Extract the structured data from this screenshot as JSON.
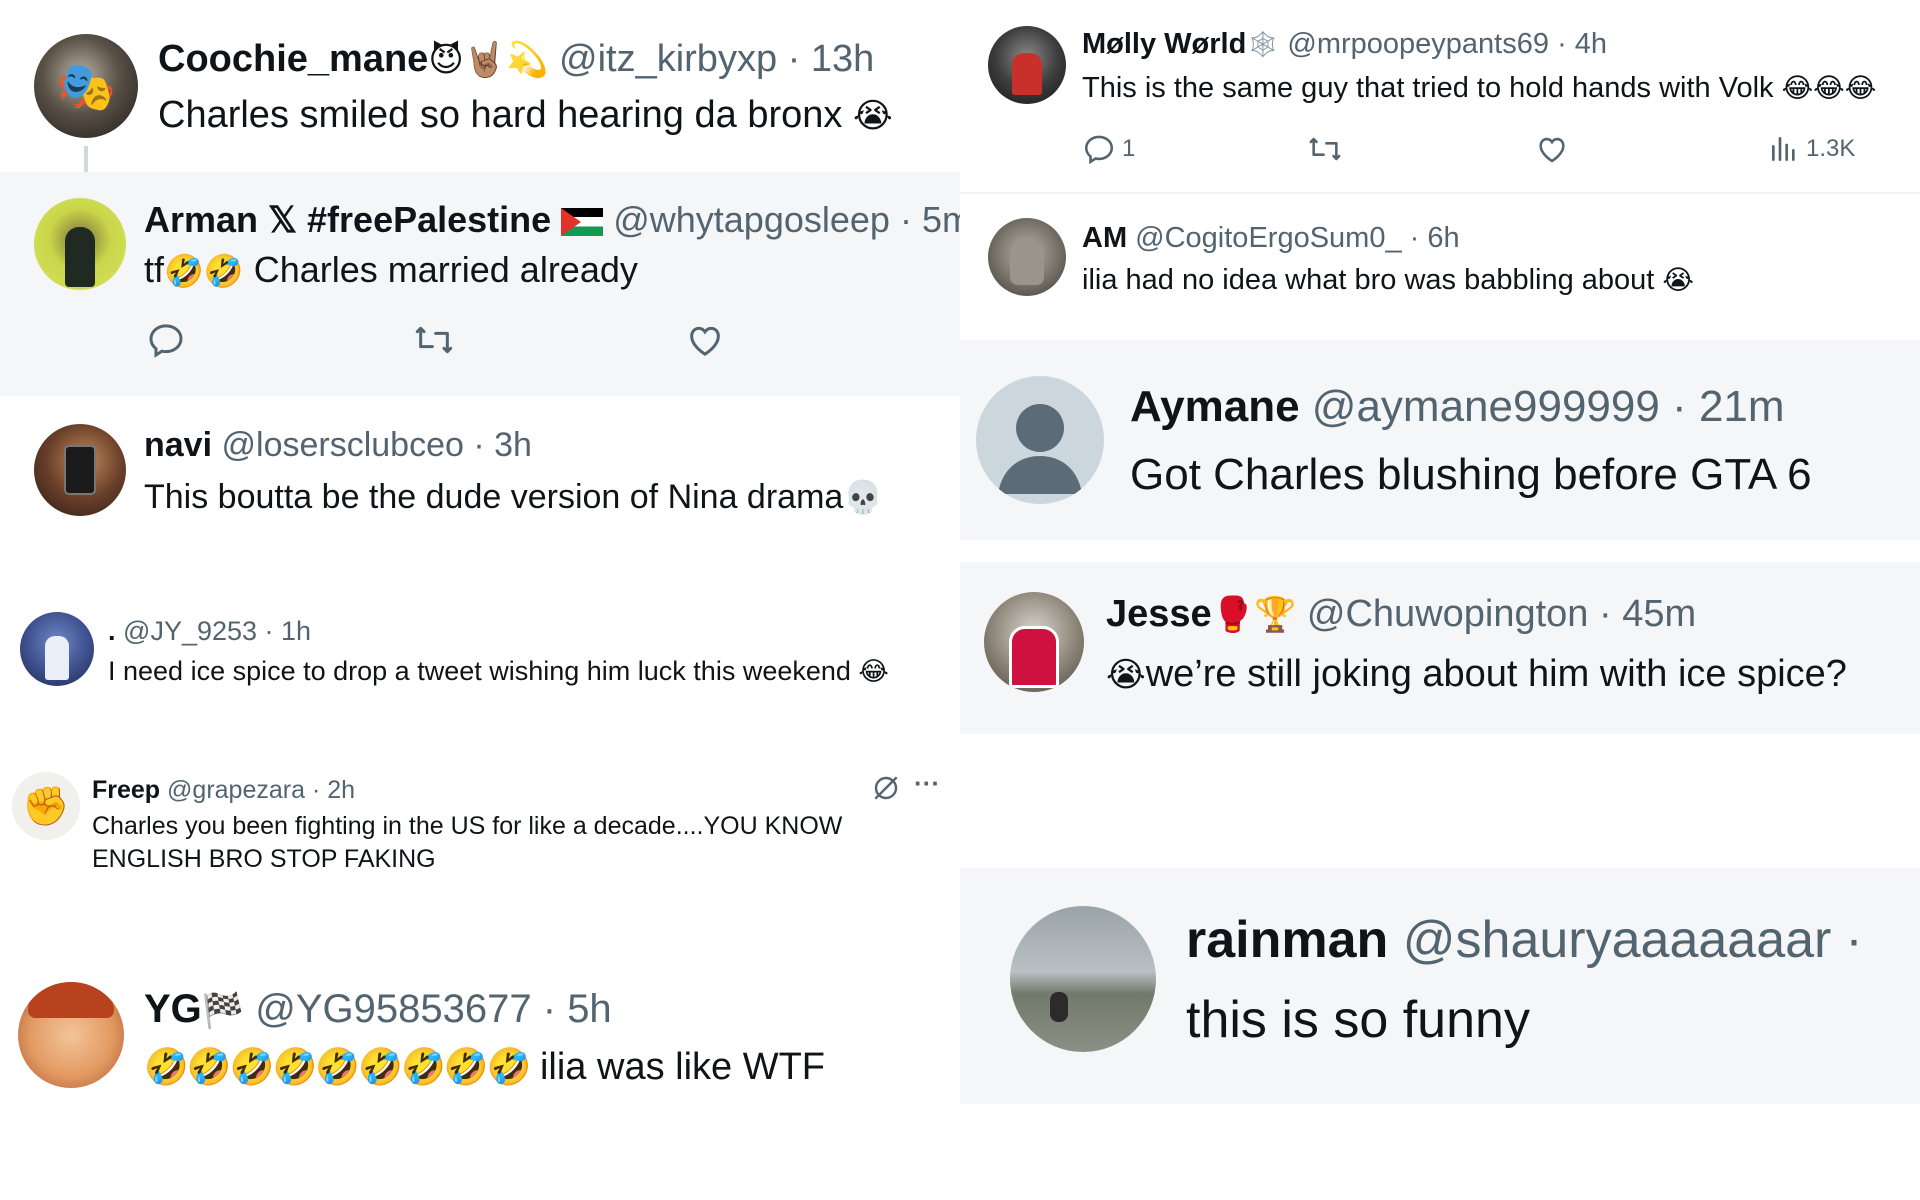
{
  "tweets": [
    {
      "name": "Coochie_mane",
      "name_emoji": "😈🤘🏽💫",
      "handle": "@itz_kirbyxp",
      "time": "13h",
      "text": "Charles smiled so hard hearing da bronx",
      "text_emoji": "😭"
    },
    {
      "name": "Arman 𝕏 #freePalestine",
      "handle": "@whytapgosleep",
      "time": "5m",
      "text_prefix": "tf",
      "text_emoji": "🤣🤣",
      "text": "Charles married already"
    },
    {
      "name": "navi",
      "handle": "@losersclubceo",
      "time": "3h",
      "text": "This boutta be the dude version of Nina drama",
      "text_emoji": "💀"
    },
    {
      "name": ".",
      "handle": "@JY_9253",
      "time": "1h",
      "text": "I need ice spice to drop a tweet wishing him luck this weekend",
      "text_emoji": "😂"
    },
    {
      "name": "Freep",
      "handle": "@grapezara",
      "time": "2h",
      "text": "Charles you been fighting in the US for like a decade....YOU KNOW ENGLISH BRO STOP FAKING",
      "more": "···"
    },
    {
      "name": "YG",
      "name_emoji": "🏁",
      "handle": "@YG95853677",
      "time": "5h",
      "text_emoji": "🤣🤣🤣🤣🤣🤣🤣🤣🤣",
      "text": "ilia was like WTF"
    },
    {
      "name": "Mølly Wørld",
      "name_emoji": "🕸",
      "handle": "@mrpoopeypants69",
      "time": "4h",
      "text": "This is the same guy that tried to hold hands with Volk",
      "text_emoji": "😂😂😂",
      "reply_count": "1",
      "view_count": "1.3K"
    },
    {
      "name": "AM",
      "handle": "@CogitoErgoSum0_",
      "time": "6h",
      "text": "ilia had no idea what bro was babbling about",
      "text_emoji": "😭"
    },
    {
      "name": "Aymane",
      "handle": "@aymane999999",
      "time": "21m",
      "text": "Got Charles blushing before GTA 6"
    },
    {
      "name": "Jesse",
      "name_emoji": "🥊🏆",
      "handle": "@Chuwopington",
      "time": "45m",
      "text_prefix_emoji": "😭",
      "text": "we’re still joking about him with ice spice?"
    },
    {
      "name": "rainman",
      "handle": "@shauryaaaaaaar",
      "time": "·",
      "text": "this is so funny"
    }
  ],
  "colors": {
    "text": "#0f1419",
    "muted": "#536471",
    "tile_gray": "#f5f6f7",
    "tile_gray2": "#eceef0"
  },
  "icons": [
    "reply-icon",
    "retweet-icon",
    "like-icon",
    "views-icon",
    "grok-icon",
    "more-icon"
  ]
}
